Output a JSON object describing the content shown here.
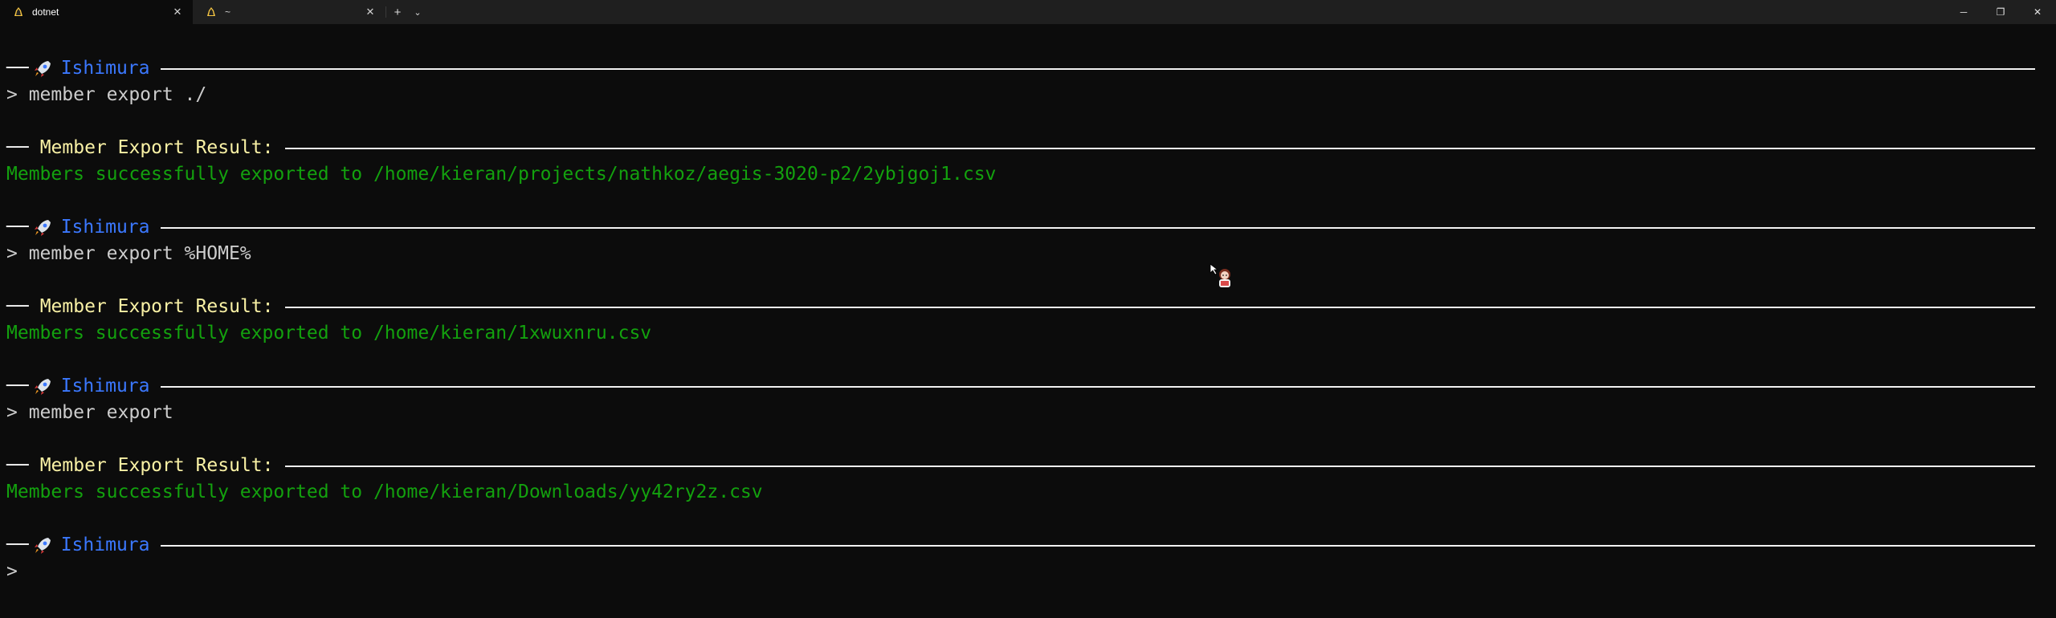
{
  "tabs": [
    {
      "title": "dotnet",
      "active": true,
      "icon": "linux-tux-icon"
    },
    {
      "title": "~",
      "active": false,
      "icon": "linux-tux-icon"
    }
  ],
  "toolbar": {
    "new_tab_label": "+",
    "dropdown_label": "⌄"
  },
  "window_controls": {
    "minimize": "─",
    "restore": "❐",
    "close": "✕"
  },
  "terminal": {
    "header_prefix": "──",
    "app_name": "Ishimura",
    "result_title": "Member Export Result:",
    "blocks": [
      {
        "command": "> member export ./",
        "result": "Members successfully exported to /home/kieran/projects/nathkoz/aegis-3020-p2/2ybjgoj1.csv"
      },
      {
        "command": "> member export %HOME%",
        "result": "Members successfully exported to /home/kieran/1xwuxnru.csv"
      },
      {
        "command": "> member export",
        "result": "Members successfully exported to /home/kieran/Downloads/yy42ry2z.csv"
      }
    ],
    "final_prompt": ">"
  },
  "colors": {
    "background": "#0c0c0c",
    "app_name": "#3b78ff",
    "result_title": "#f9f1a5",
    "success": "#13a10e",
    "text": "#cccccc"
  }
}
